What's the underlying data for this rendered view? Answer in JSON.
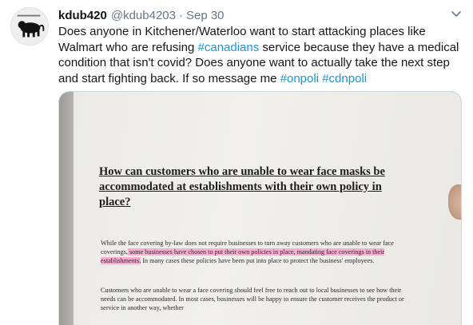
{
  "tweet": {
    "display_name": "kdub420",
    "handle": "@kdub4203",
    "separator": "·",
    "date": "Sep 30",
    "more_icon": "chevron-down-icon",
    "text_parts": {
      "t1": "Does anyone in Kitchener/Waterloo want to start attacking places like Walmart who are refusing ",
      "tag1": "#canadians",
      "t2": " service because they have a medical condition that isn't covid? Does anyone want to actually take the next step and start fighting back. If so message me ",
      "tag2": "#onpoli",
      "t3": " ",
      "tag3": "#cdnpoli"
    },
    "hashtag_color": "#1b95e0"
  },
  "media": {
    "heading": "How can customers who are unable to wear face masks be accommodated at establishments with their own policy in place?",
    "para1": {
      "a": "While the face covering by-law does not require businesses to turn away customers who are unable to wear face coverings,",
      "highlight": " some businesses have chosen to put their own policies in place, mandating face coverings in their establishments.",
      "b": " In many cases these policies have been put into place to protect the business' employees."
    },
    "para2": "Customers who are unable to wear a face covering should feel free to reach out to local businesses to see how their needs can be accommodated. In most cases, businesses will be happy to ensure the customer receives the product or service in another way, whether",
    "highlight_color": "#ff78be"
  }
}
